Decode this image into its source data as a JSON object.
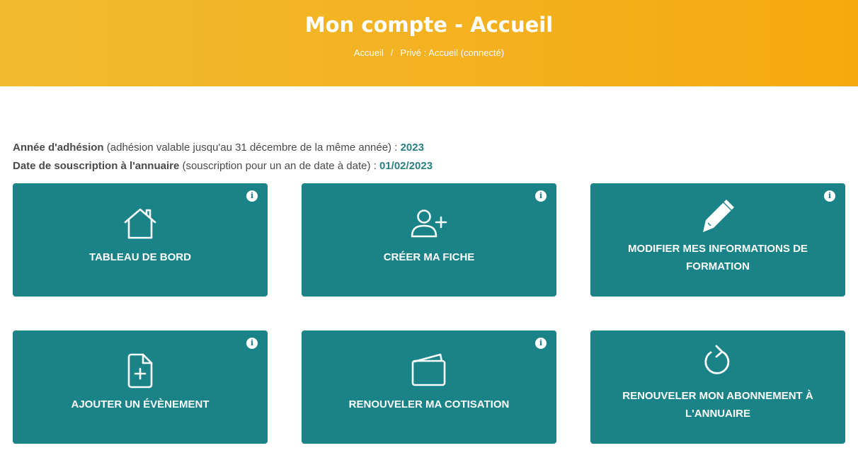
{
  "header": {
    "title": "Mon compte - Accueil",
    "breadcrumb": [
      "Accueil",
      "Privé : Accueil (connecté)"
    ],
    "breadcrumb_separator": "/"
  },
  "info": {
    "membership": {
      "label": "Année d'adhésion",
      "description": "(adhésion valable jusqu'au 31 décembre de la même année) :",
      "value": "2023"
    },
    "directory": {
      "label": "Date de souscription à l'annuaire",
      "description": "(souscription pour un an de date à date) :",
      "value": "01/02/2023"
    }
  },
  "tiles": [
    {
      "label": "TABLEAU DE BORD",
      "icon": "home-icon",
      "has_info": true
    },
    {
      "label": "CRÉER MA FICHE",
      "icon": "user-plus-icon",
      "has_info": true
    },
    {
      "label": "MODIFIER MES INFORMATIONS DE FORMATION",
      "icon": "pencil-icon",
      "has_info": true
    },
    {
      "label": "AJOUTER UN ÉVÈNEMENT",
      "icon": "file-plus-icon",
      "has_info": true
    },
    {
      "label": "RENOUVELER MA COTISATION",
      "icon": "wallet-icon",
      "has_info": true
    },
    {
      "label": "RENOUVELER MON ABONNEMENT À L'ANNUAIRE",
      "icon": "refresh-icon",
      "has_info": false
    }
  ],
  "info_glyph": "i",
  "colors": {
    "accent_teal": "#198387",
    "header_yellow": "#f4b01e",
    "value_teal": "#2a7f84"
  }
}
